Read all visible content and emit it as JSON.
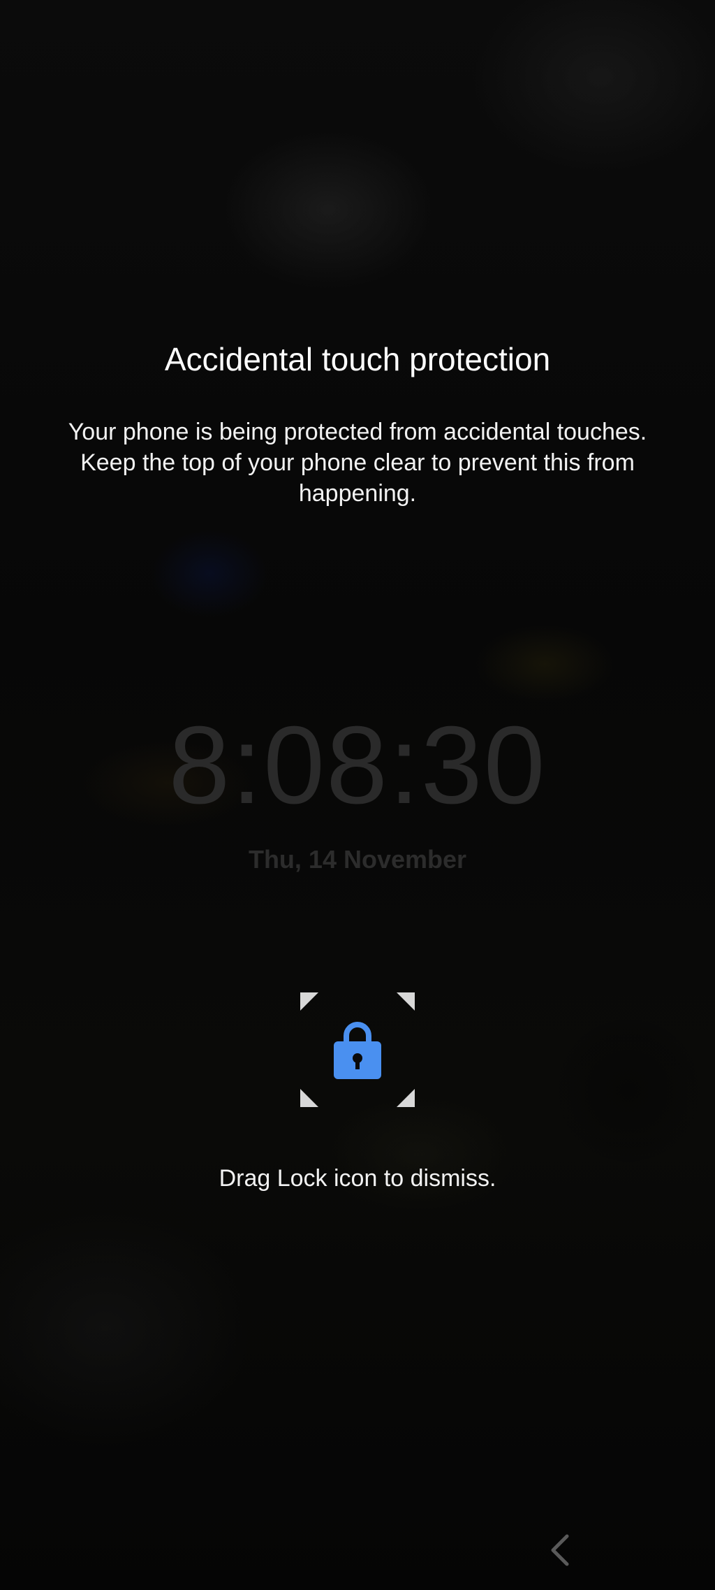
{
  "dialog": {
    "title": "Accidental touch protection",
    "description": "Your phone is being protected from accidental touches. Keep the top of your phone clear to prevent this from happening.",
    "hint": "Drag Lock icon to dismiss."
  },
  "lockscreen": {
    "time": "8:08:30",
    "date": "Thu, 14 November"
  },
  "icons": {
    "lock": "lock-icon",
    "corner_markers": "corner-bracket-icon",
    "back": "chevron-left-icon"
  },
  "colors": {
    "accent": "#4a90f0",
    "text": "#ffffff",
    "dim_clock": "#2a2a2a"
  }
}
